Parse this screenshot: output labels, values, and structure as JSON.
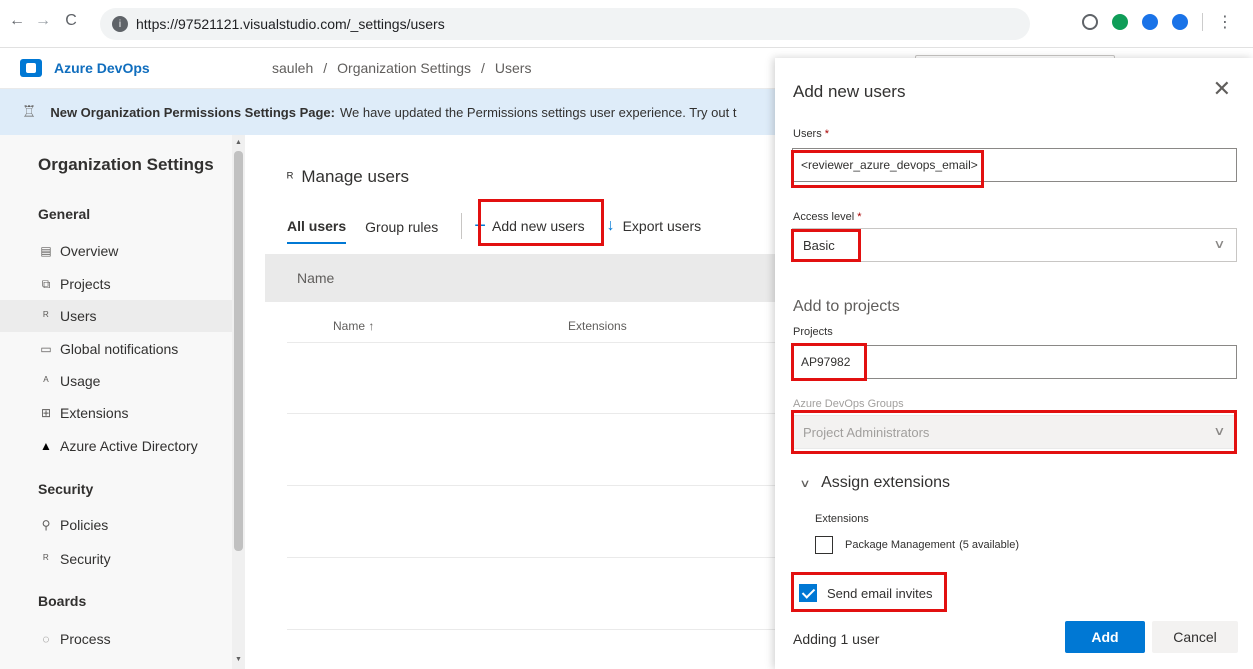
{
  "browser": {
    "url": "https://97521121.visualstudio.com/_settings/users",
    "back": "←",
    "forward": "→",
    "reload": "C"
  },
  "header": {
    "brand": "Azure DevOps",
    "breadcrumb": [
      "sauleh",
      "/",
      "Organization Settings",
      "/",
      "Users"
    ]
  },
  "banner": {
    "bold_text": "New Organization Permissions Settings Page:",
    "text": "We have updated the Permissions settings user experience. Try out t"
  },
  "sidebar": {
    "title": "Organization Settings",
    "sections": {
      "general": "General",
      "security": "Security",
      "boards": "Boards"
    },
    "general_items": [
      {
        "label": "Overview",
        "icon": "▤"
      },
      {
        "label": "Projects",
        "icon": "⧉"
      },
      {
        "label": "Users",
        "icon": "ᴿ"
      },
      {
        "label": "Global notifications",
        "icon": "▭"
      },
      {
        "label": "Usage",
        "icon": "ᴬ"
      },
      {
        "label": "Extensions",
        "icon": "⊞"
      },
      {
        "label": "Azure Active Directory",
        "icon": "▲"
      }
    ],
    "security_items": [
      {
        "label": "Policies",
        "icon": "⚲"
      },
      {
        "label": "Security",
        "icon": "ᴿ"
      }
    ],
    "boards_items": [
      {
        "label": "Process",
        "icon": "◌"
      }
    ]
  },
  "main": {
    "title": "Manage users",
    "tabs": [
      {
        "label": "All users"
      },
      {
        "label": "Group rules"
      }
    ],
    "commands": {
      "add": "Add new users",
      "export": "Export users"
    },
    "grid_header": "Name",
    "columns": {
      "name": "Name ↑",
      "extensions": "Extensions"
    }
  },
  "panel": {
    "title": "Add new users",
    "users_label": "Users",
    "required_mark": "*",
    "users_value": "<reviewer_azure_devops_email>",
    "access_label": "Access level",
    "access_value": "Basic",
    "add_to_projects": "Add to projects",
    "projects_label": "Projects",
    "projects_value": "AP97982",
    "groups_label": "Azure DevOps Groups",
    "groups_value": "Project Administrators",
    "assign_extensions": "Assign extensions",
    "extensions_label": "Extensions",
    "package_management": "Package Management",
    "package_available": "(5 available)",
    "send_invites": "Send email invites",
    "footer_text": "Adding 1 user",
    "add_button": "Add",
    "cancel_button": "Cancel"
  },
  "colors": {
    "accent": "#0078d4",
    "highlight": "#e21010",
    "banner": "#deecf9"
  }
}
